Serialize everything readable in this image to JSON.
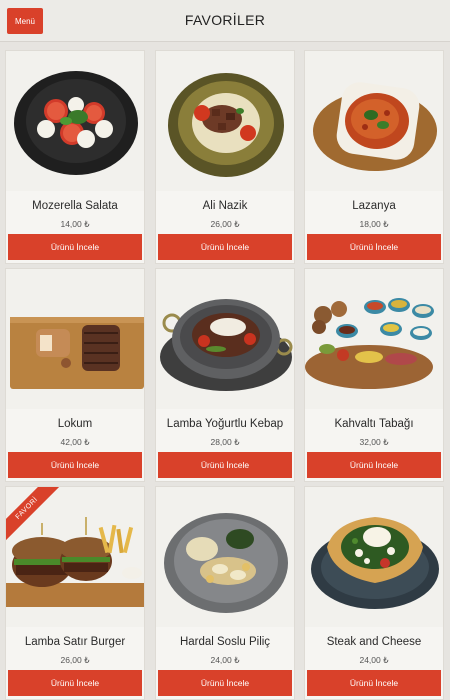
{
  "header": {
    "menu_label": "Menü",
    "title": "FAVORİLER"
  },
  "products": [
    {
      "name": "Mozerella Salata",
      "price": "14,00 ₺",
      "button": "Ürünü İncele"
    },
    {
      "name": "Ali Nazik",
      "price": "26,00 ₺",
      "button": "Ürünü İncele"
    },
    {
      "name": "Lazanya",
      "price": "18,00 ₺",
      "button": "Ürünü İncele"
    },
    {
      "name": "Lokum",
      "price": "42,00 ₺",
      "button": "Ürünü İncele"
    },
    {
      "name": "Lamba Yoğurtlu Kebap",
      "price": "28,00 ₺",
      "button": "Ürünü İncele"
    },
    {
      "name": "Kahvaltı Tabağı",
      "price": "32,00 ₺",
      "button": "Ürünü İncele"
    },
    {
      "name": "Lamba Satır Burger",
      "price": "26,00 ₺",
      "button": "Ürünü İncele",
      "badge": "FAVORİ"
    },
    {
      "name": "Hardal Soslu Piliç",
      "price": "24,00 ₺",
      "button": "Ürünü İncele"
    },
    {
      "name": "Steak and Cheese",
      "price": "24,00 ₺",
      "button": "Ürünü İncele"
    }
  ],
  "colors": {
    "accent": "#d9412a",
    "background": "#e6e4e0",
    "card": "#f6f5f2"
  }
}
